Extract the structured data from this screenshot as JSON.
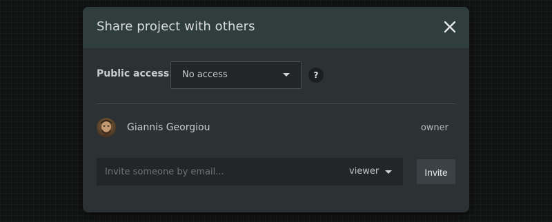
{
  "dialog": {
    "title": "Share project with others",
    "close_icon": "close-icon"
  },
  "public_access": {
    "label": "Public access:",
    "selected": "No access",
    "help_glyph": "?"
  },
  "members": [
    {
      "name": "Giannis Georgiou",
      "role": "owner",
      "avatar_icon": "user-avatar"
    }
  ],
  "invite": {
    "placeholder": "Invite someone by email...",
    "value": "",
    "role": "viewer",
    "button_label": "Invite"
  },
  "colors": {
    "modal_bg": "#2c3134",
    "header_bg": "#2f3d3d",
    "input_bg": "#222627",
    "button_bg": "#3b4144",
    "text": "#c8cdcf"
  }
}
